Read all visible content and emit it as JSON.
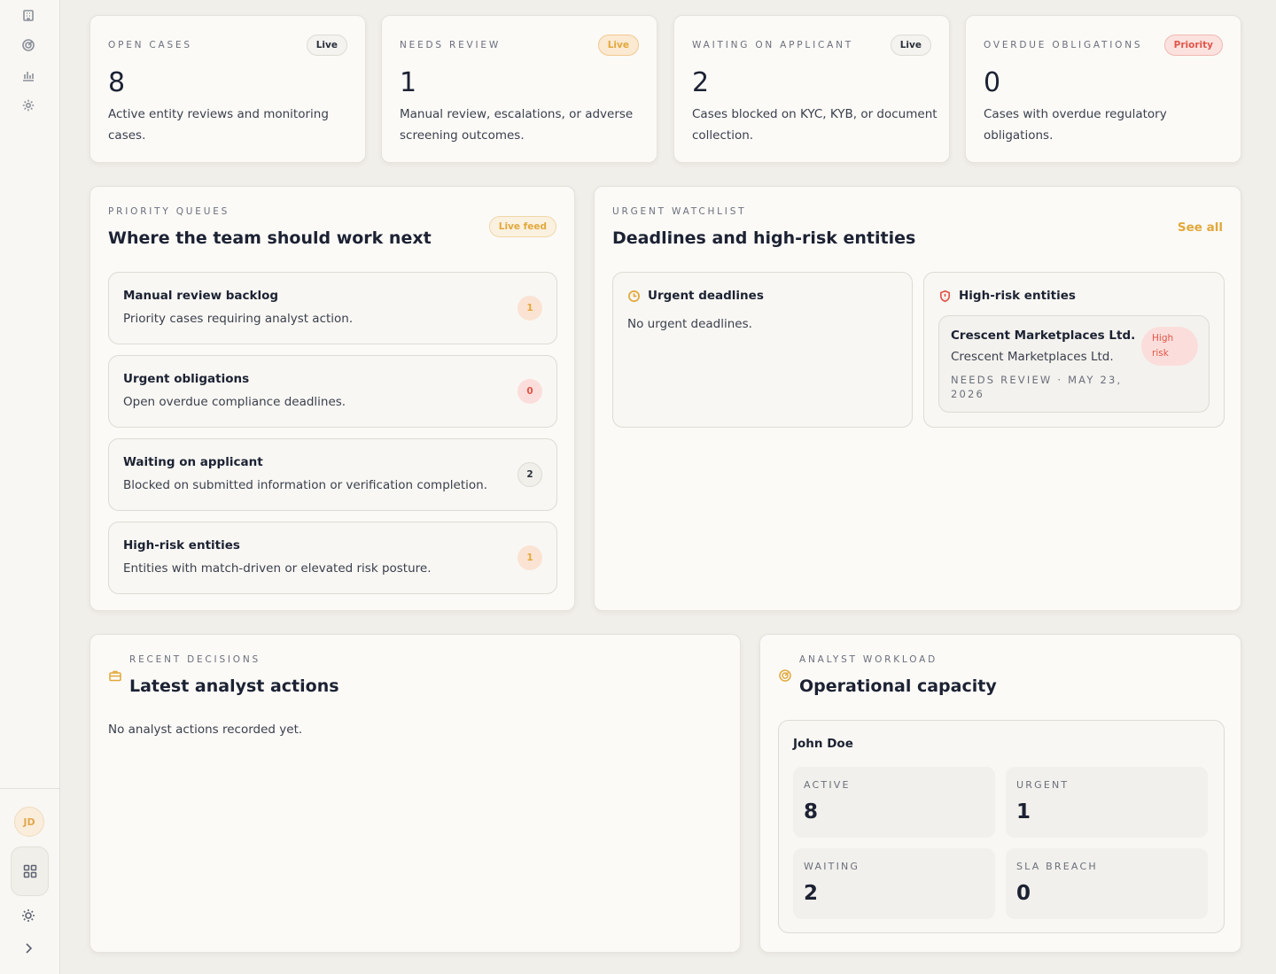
{
  "sidebar": {
    "icons": [
      "building-icon",
      "radar-icon",
      "chart-icon",
      "gear-icon"
    ],
    "avatar_initials": "JD"
  },
  "stats": [
    {
      "label": "OPEN CASES",
      "badge": "Live",
      "value": "8",
      "desc": "Active entity reviews and monitoring cases."
    },
    {
      "label": "NEEDS REVIEW",
      "badge": "Live",
      "value": "1",
      "desc": "Manual review, escalations, or adverse screening outcomes."
    },
    {
      "label": "WAITING ON APPLICANT",
      "badge": "Live",
      "value": "2",
      "desc": "Cases blocked on KYC, KYB, or document collection."
    },
    {
      "label": "OVERDUE OBLIGATIONS",
      "badge": "Priority",
      "value": "0",
      "desc": "Cases with overdue regulatory obligations."
    }
  ],
  "priority": {
    "eyebrow": "PRIORITY QUEUES",
    "title": "Where the team should work next",
    "badge": "Live feed",
    "queues": [
      {
        "title": "Manual review backlog",
        "desc": "Priority cases requiring analyst action.",
        "count": "1"
      },
      {
        "title": "Urgent obligations",
        "desc": "Open overdue compliance deadlines.",
        "count": "0"
      },
      {
        "title": "Waiting on applicant",
        "desc": "Blocked on submitted information or verification completion.",
        "count": "2"
      },
      {
        "title": "High-risk entities",
        "desc": "Entities with match-driven or elevated risk posture.",
        "count": "1"
      }
    ]
  },
  "watchlist": {
    "eyebrow": "URGENT WATCHLIST",
    "title": "Deadlines and high-risk entities",
    "see_all": "See all",
    "deadlines_title": "Urgent deadlines",
    "deadlines_empty": "No urgent deadlines.",
    "risk_title": "High-risk entities",
    "entity": {
      "name": "Crescent Marketplaces Ltd.",
      "sub": "Crescent Marketplaces Ltd.",
      "badge_line1": "High",
      "badge_line2": "risk",
      "meta_line1": "NEEDS REVIEW · MAY 23,",
      "meta_line2": "2026"
    }
  },
  "decisions": {
    "eyebrow": "RECENT DECISIONS",
    "title": "Latest analyst actions",
    "empty": "No analyst actions recorded yet."
  },
  "workload": {
    "eyebrow": "ANALYST WORKLOAD",
    "title": "Operational capacity",
    "analyst": "John Doe",
    "metrics": [
      {
        "label": "ACTIVE",
        "value": "8"
      },
      {
        "label": "URGENT",
        "value": "1"
      },
      {
        "label": "WAITING",
        "value": "2"
      },
      {
        "label": "SLA BREACH",
        "value": "0"
      }
    ]
  },
  "colors": {
    "accent": "#e2a83b",
    "danger": "#e0564a",
    "ink": "#1c2233"
  }
}
